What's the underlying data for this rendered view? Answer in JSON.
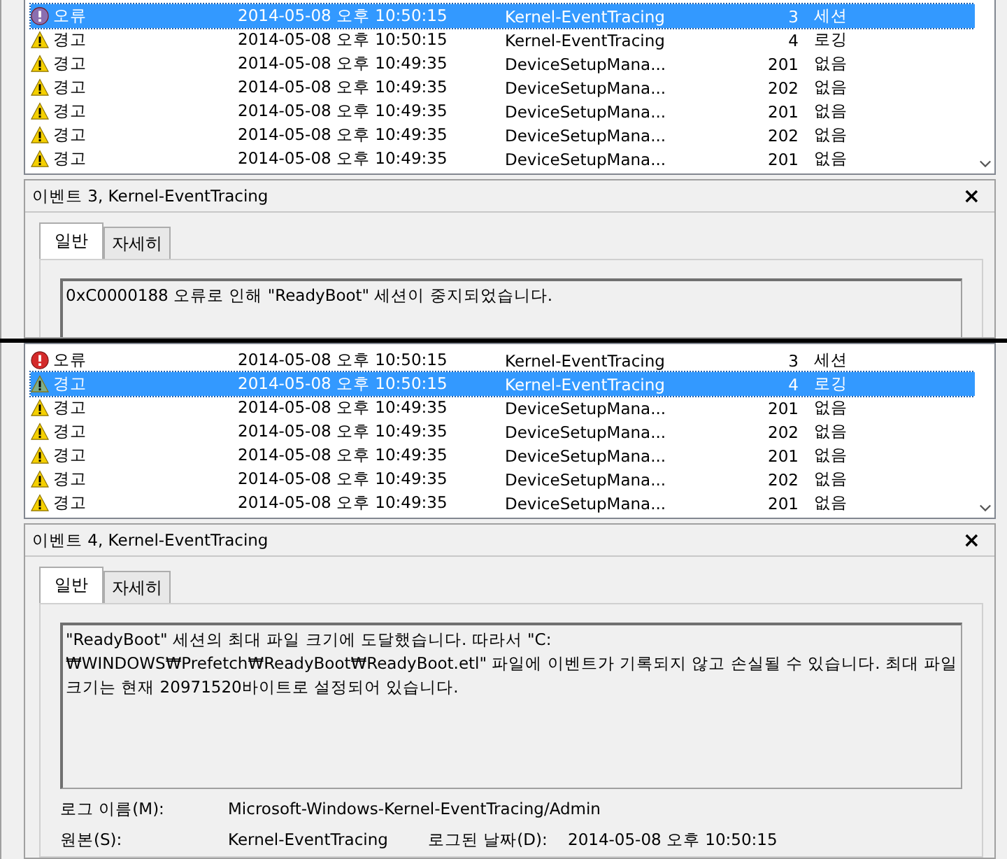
{
  "panels": [
    {
      "events": [
        {
          "kind": "error",
          "level": "오류",
          "date": "2014-05-08 오후 10:50:15",
          "source": "Kernel-EventTracing",
          "id": "3",
          "category": "세션",
          "selected": true
        },
        {
          "kind": "warning",
          "level": "경고",
          "date": "2014-05-08 오후 10:50:15",
          "source": "Kernel-EventTracing",
          "id": "4",
          "category": "로깅",
          "selected": false
        },
        {
          "kind": "warning",
          "level": "경고",
          "date": "2014-05-08 오후 10:49:35",
          "source": "DeviceSetupMana...",
          "id": "201",
          "category": "없음",
          "selected": false
        },
        {
          "kind": "warning",
          "level": "경고",
          "date": "2014-05-08 오후 10:49:35",
          "source": "DeviceSetupMana...",
          "id": "202",
          "category": "없음",
          "selected": false
        },
        {
          "kind": "warning",
          "level": "경고",
          "date": "2014-05-08 오후 10:49:35",
          "source": "DeviceSetupMana...",
          "id": "201",
          "category": "없음",
          "selected": false
        },
        {
          "kind": "warning",
          "level": "경고",
          "date": "2014-05-08 오후 10:49:35",
          "source": "DeviceSetupMana...",
          "id": "202",
          "category": "없음",
          "selected": false
        },
        {
          "kind": "warning",
          "level": "경고",
          "date": "2014-05-08 오후 10:49:35",
          "source": "DeviceSetupMana...",
          "id": "201",
          "category": "없음",
          "selected": false
        }
      ],
      "detail": {
        "title": "이벤트 3, Kernel-EventTracing",
        "close": "×",
        "tabs": [
          {
            "label": "일반",
            "selected": true
          },
          {
            "label": "자세히",
            "selected": false
          }
        ],
        "message": "0xC0000188 오류로 인해 \"ReadyBoot\" 세션이 중지되었습니다."
      }
    },
    {
      "events": [
        {
          "kind": "error",
          "level": "오류",
          "date": "2014-05-08 오후 10:50:15",
          "source": "Kernel-EventTracing",
          "id": "3",
          "category": "세션",
          "selected": false
        },
        {
          "kind": "warning",
          "level": "경고",
          "date": "2014-05-08 오후 10:50:15",
          "source": "Kernel-EventTracing",
          "id": "4",
          "category": "로깅",
          "selected": true
        },
        {
          "kind": "warning",
          "level": "경고",
          "date": "2014-05-08 오후 10:49:35",
          "source": "DeviceSetupMana...",
          "id": "201",
          "category": "없음",
          "selected": false
        },
        {
          "kind": "warning",
          "level": "경고",
          "date": "2014-05-08 오후 10:49:35",
          "source": "DeviceSetupMana...",
          "id": "202",
          "category": "없음",
          "selected": false
        },
        {
          "kind": "warning",
          "level": "경고",
          "date": "2014-05-08 오후 10:49:35",
          "source": "DeviceSetupMana...",
          "id": "201",
          "category": "없음",
          "selected": false
        },
        {
          "kind": "warning",
          "level": "경고",
          "date": "2014-05-08 오후 10:49:35",
          "source": "DeviceSetupMana...",
          "id": "202",
          "category": "없음",
          "selected": false
        },
        {
          "kind": "warning",
          "level": "경고",
          "date": "2014-05-08 오후 10:49:35",
          "source": "DeviceSetupMana...",
          "id": "201",
          "category": "없음",
          "selected": false
        }
      ],
      "detail": {
        "title": "이벤트 4, Kernel-EventTracing",
        "close": "×",
        "tabs": [
          {
            "label": "일반",
            "selected": true
          },
          {
            "label": "자세히",
            "selected": false
          }
        ],
        "message": "\"ReadyBoot\" 세션의 최대 파일 크기에 도달했습니다. 따라서 \"C:₩WINDOWS₩Prefetch₩ReadyBoot₩ReadyBoot.etl\" 파일에 이벤트가 기록되지 않고 손실될 수 있습니다. 최대 파일 크기는 현재 20971520바이트로 설정되어 있습니다.",
        "fields": [
          [
            {
              "label": "로그 이름(M):",
              "value": "Microsoft-Windows-Kernel-EventTracing/Admin"
            }
          ],
          [
            {
              "label": "원본(S):",
              "value": "Kernel-EventTracing"
            },
            {
              "label": "로그된 날짜(D):",
              "value": "2014-05-08 오후 10:50:15"
            }
          ]
        ]
      }
    }
  ]
}
